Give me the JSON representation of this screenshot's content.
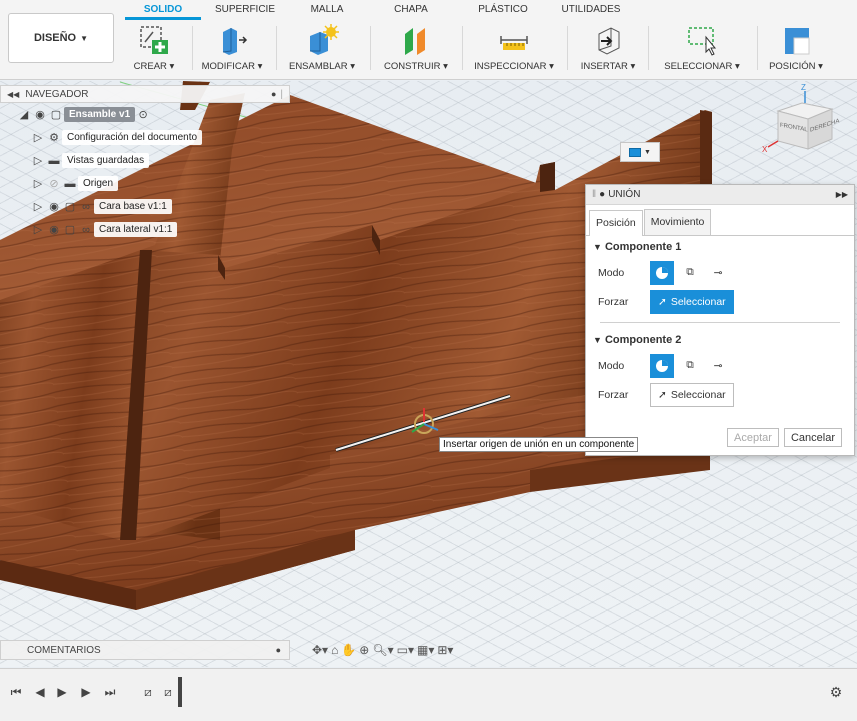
{
  "toolbar": {
    "workspace": "DISEÑO",
    "tabs": [
      "SOLIDO",
      "SUPERFICIE",
      "MALLA",
      "CHAPA",
      "PLÁSTICO",
      "UTILIDADES"
    ],
    "groups": {
      "crear": "CREAR",
      "modificar": "MODIFICAR",
      "ensamblar": "ENSAMBLAR",
      "construir": "CONSTRUIR",
      "inspeccionar": "INSPECCIONAR",
      "insertar": "INSERTAR",
      "seleccionar": "SELECCIONAR",
      "posicion": "POSICIÓN"
    }
  },
  "navigator": {
    "title": "NAVEGADOR",
    "items": [
      {
        "label": "Ensamble v1"
      },
      {
        "label": "Configuración del documento"
      },
      {
        "label": "Vistas guardadas"
      },
      {
        "label": "Origen"
      },
      {
        "label": "Cara base v1:1"
      },
      {
        "label": "Cara lateral v1:1"
      }
    ]
  },
  "joint_dialog": {
    "title": "UNIÓN",
    "tabs": [
      "Posición",
      "Movimiento"
    ],
    "component1": {
      "title": "Componente 1",
      "mode_label": "Modo",
      "snap_label": "Forzar",
      "select_label": "Seleccionar"
    },
    "component2": {
      "title": "Componente 2",
      "mode_label": "Modo",
      "snap_label": "Forzar",
      "select_label": "Seleccionar"
    },
    "ok": "Aceptar",
    "cancel": "Cancelar"
  },
  "tooltip": "Insertar origen de unión en un componente",
  "comments": {
    "title": "COMENTARIOS"
  },
  "viewcube": {
    "front": "FRONTAL",
    "right": "DERECHA",
    "axis_z": "Z",
    "axis_x": "X"
  },
  "colors": {
    "accent": "#0696d7",
    "wood": "#8b4a2b",
    "selected": "#1a8fd9"
  }
}
